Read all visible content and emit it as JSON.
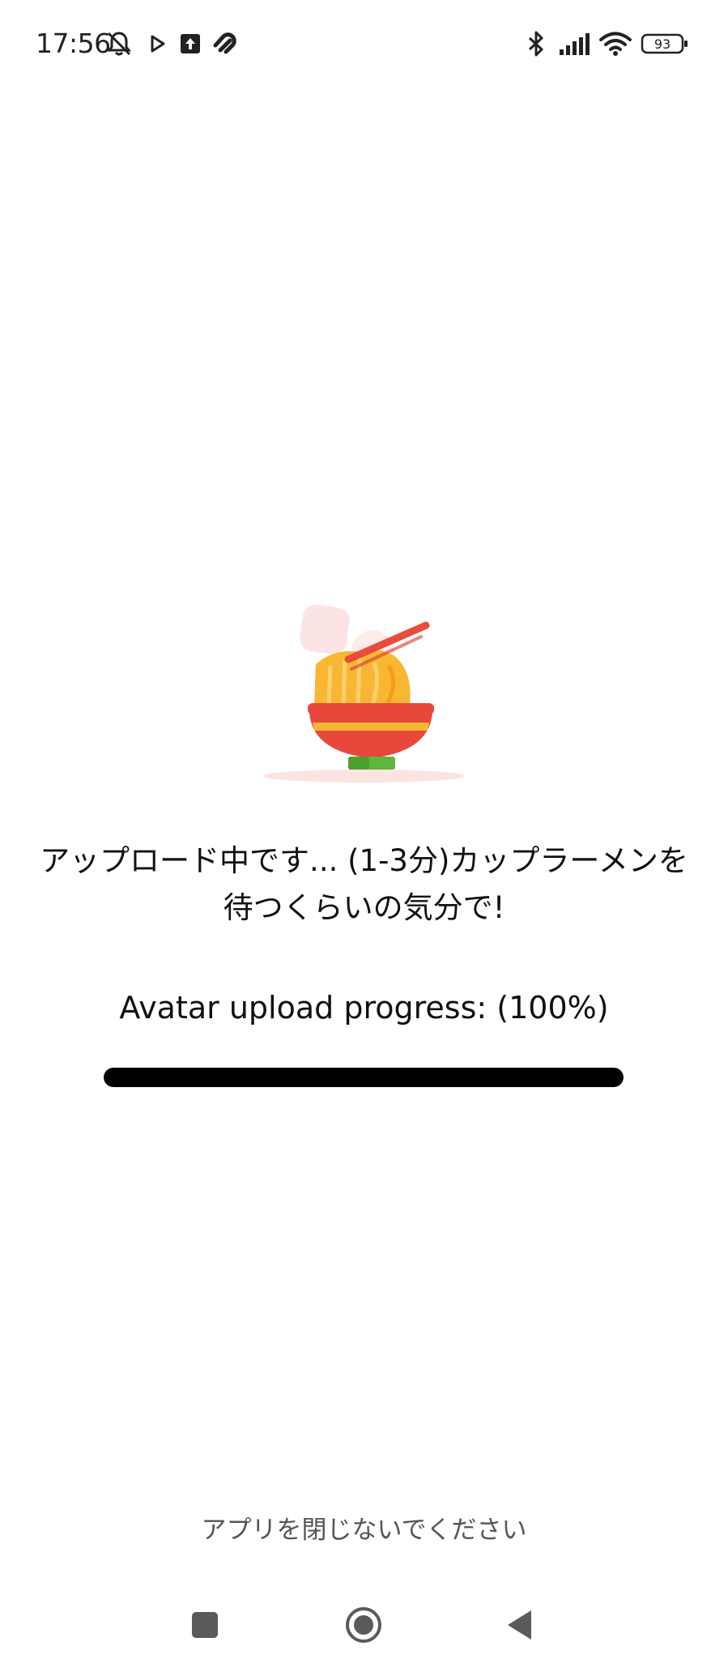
{
  "status_bar": {
    "time": "17:56",
    "battery_level": "93",
    "icons": [
      "notifications-muted-icon",
      "play-icon",
      "upload-icon",
      "app-notification-icon",
      "bluetooth-icon",
      "signal-icon",
      "wifi-icon",
      "battery-icon"
    ]
  },
  "illustration": {
    "icon": "ramen-bowl-icon"
  },
  "upload": {
    "message": "アップロード中です... (1-3分)カップラーメンを待つくらいの気分で!",
    "progress_label": "Avatar upload progress: (100%)",
    "progress_percent": 100
  },
  "footer": {
    "note": "アプリを閉じないでください"
  },
  "nav_bar": {
    "buttons": [
      "recents-icon",
      "home-icon",
      "back-icon"
    ]
  },
  "colors": {
    "progress_fill": "#000000",
    "bowl_red": "#e8473c",
    "noodle_yellow": "#f7b733",
    "chopstick_red": "#e94b3c",
    "bowl_base_green": "#5fb63a"
  }
}
